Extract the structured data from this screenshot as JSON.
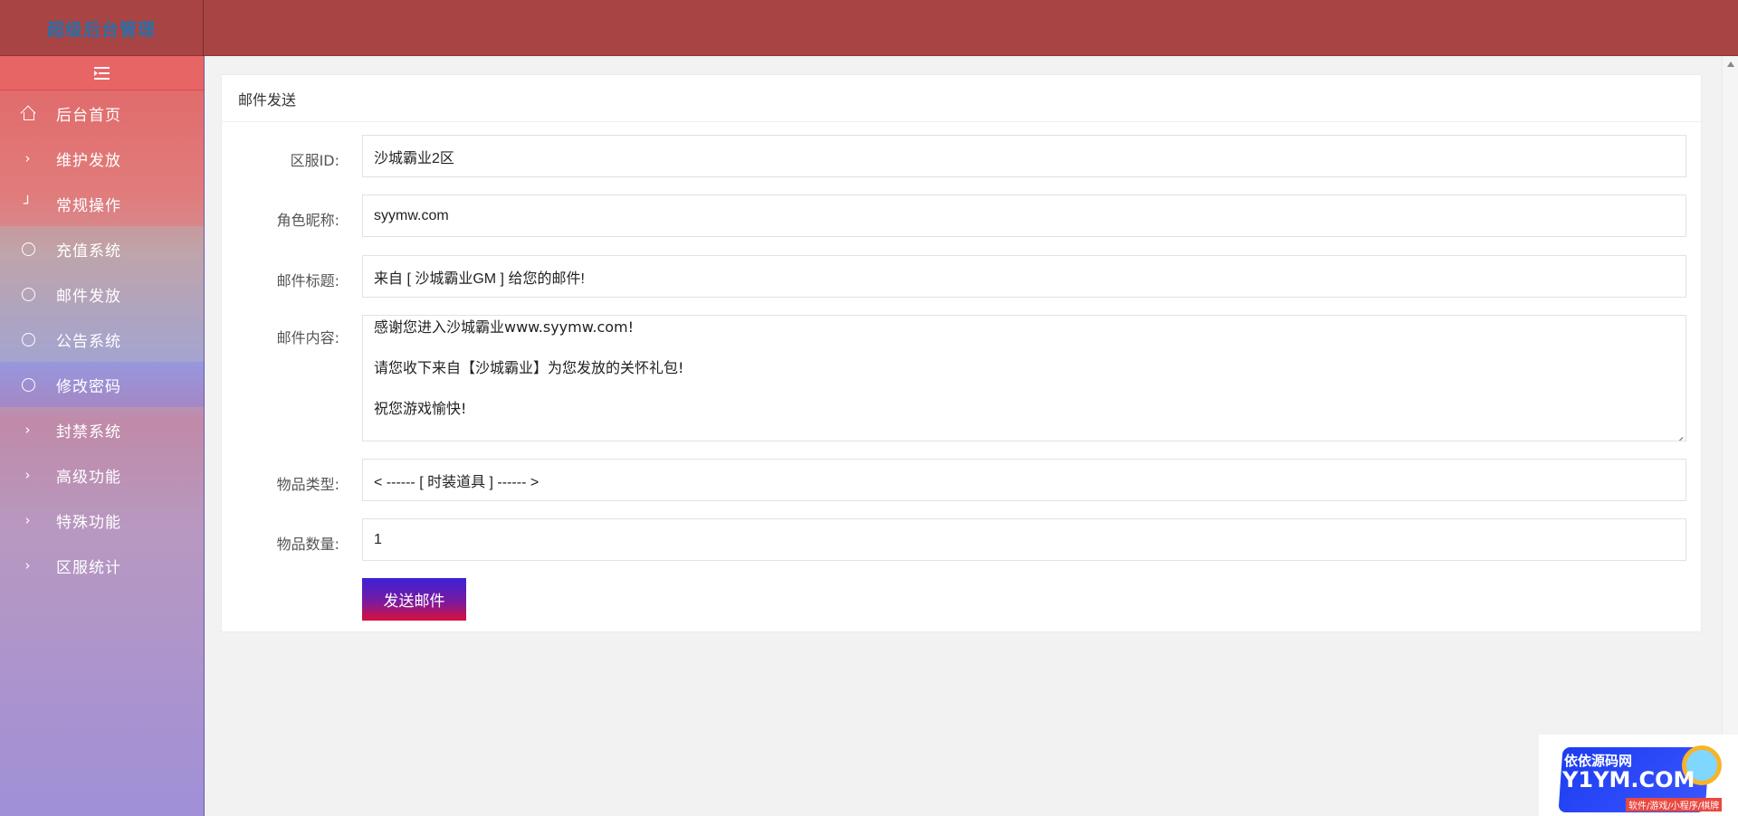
{
  "header": {
    "brand": "超级后台管理"
  },
  "sidebar": {
    "items": [
      {
        "label": "后台首页",
        "icon": "home-icon"
      },
      {
        "label": "维护发放",
        "icon": "chevron-right-icon"
      },
      {
        "label": "常规操作",
        "icon": "corner-icon"
      },
      {
        "label": "充值系统",
        "icon": "circle-icon"
      },
      {
        "label": "邮件发放",
        "icon": "circle-icon"
      },
      {
        "label": "公告系统",
        "icon": "circle-icon"
      },
      {
        "label": "修改密码",
        "icon": "circle-icon"
      },
      {
        "label": "封禁系统",
        "icon": "chevron-right-icon"
      },
      {
        "label": "高级功能",
        "icon": "chevron-right-icon"
      },
      {
        "label": "特殊功能",
        "icon": "chevron-right-icon"
      },
      {
        "label": "区服统计",
        "icon": "chevron-right-icon"
      }
    ]
  },
  "card": {
    "title": "邮件发送",
    "form": {
      "server_label": "区服ID:",
      "server_value": "沙城霸业2区",
      "role_label": "角色昵称:",
      "role_value": "syymw.com",
      "subject_label": "邮件标题:",
      "subject_value": "来自 [ 沙城霸业GM ] 给您的邮件!",
      "content_label": "邮件内容:",
      "content_lines": [
        "感谢您进入沙城霸业www.syymw.com!",
        "请您收下来自【沙城霸业】为您发放的关怀礼包!",
        "祝您游戏愉快!"
      ],
      "item_type_label": "物品类型:",
      "item_type_value": "< ------ [ 时装道具 ] ------ >",
      "item_count_label": "物品数量:",
      "item_count_value": "1",
      "submit_label": "发送邮件"
    }
  },
  "watermark": {
    "line1": "依依源码网",
    "line2": "Y1YM.COM",
    "line3": "软件/游戏/小程序/棋牌"
  },
  "colors": {
    "header_bg": "#a84444",
    "brand_text": "#2a6fa8",
    "button_gradient_top": "#3a22d6",
    "button_gradient_bottom": "#d8103a"
  }
}
